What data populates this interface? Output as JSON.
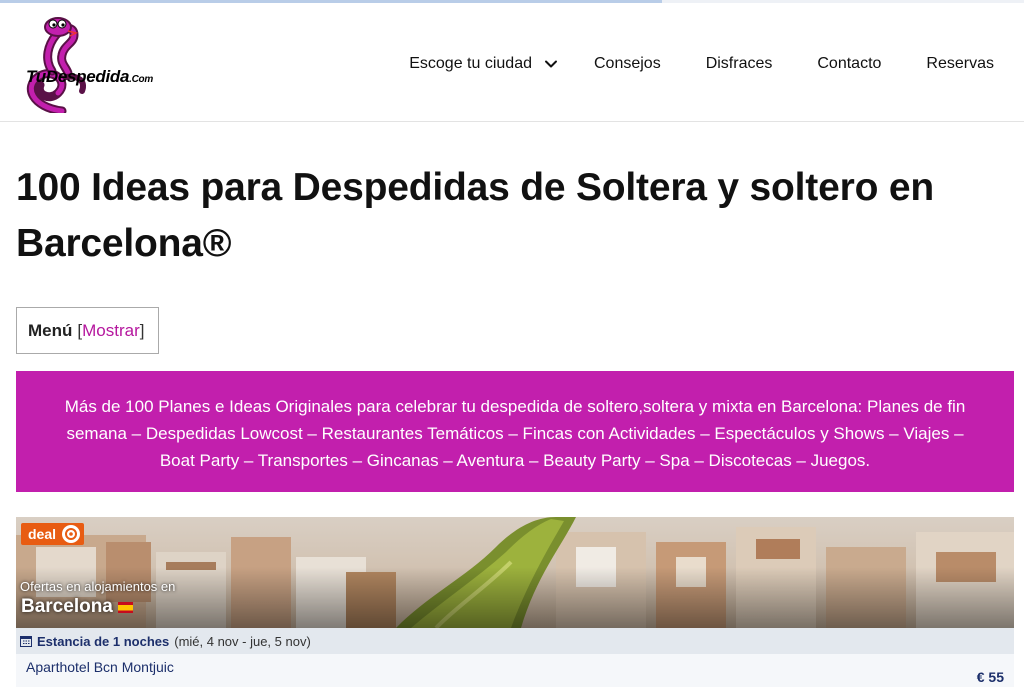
{
  "site": {
    "logo_text_main": "TuDespedida",
    "logo_text_suffix": ".Com",
    "brand_color": "#c21fad"
  },
  "nav": {
    "items": [
      {
        "label": "Escoge tu ciudad",
        "has_dropdown": true
      },
      {
        "label": "Consejos"
      },
      {
        "label": "Disfraces"
      },
      {
        "label": "Contacto"
      },
      {
        "label": "Reservas"
      }
    ]
  },
  "page": {
    "title": "100 Ideas para Despedidas de Soltera y soltero en Barcelona®"
  },
  "toc": {
    "label": "Menú",
    "bracket_open": "[",
    "toggle_label": "Mostrar",
    "bracket_close": "]"
  },
  "banner": {
    "text": "Más de 100 Planes e Ideas Originales para celebrar tu despedida de soltero,soltera y mixta en Barcelona: Planes de fin semana – Despedidas Lowcost – Restaurantes Temáticos – Fincas con Actividades – Espectáculos y Shows – Viajes – Boat Party – Transportes – Gincanas – Aventura – Beauty Party – Spa – Discotecas – Juegos."
  },
  "hotel_widget": {
    "badge": "deal",
    "subtitle": "Ofertas en alojamientos en",
    "city": "Barcelona",
    "stay_label": "Estancia de 1 noches",
    "stay_dates": "(mié, 4 nov - jue, 5 nov)",
    "hotels": [
      {
        "name": "Aparthotel Bcn Montjuic",
        "price": "€ 55"
      }
    ]
  }
}
